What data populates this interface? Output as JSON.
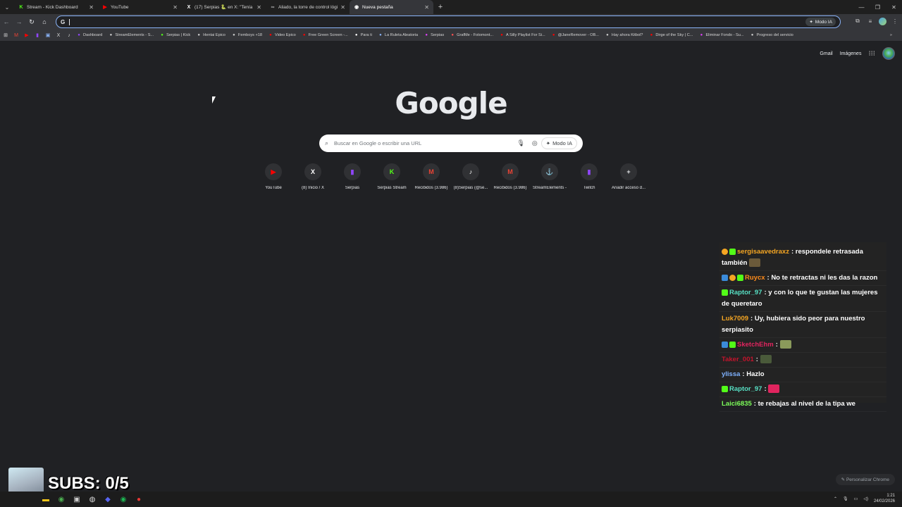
{
  "tabs": [
    {
      "title": "Stream - Kick Dashboard",
      "favicon": "kick-icon",
      "color": "#53fc18",
      "glyph": "K"
    },
    {
      "title": "YouTube",
      "favicon": "youtube-icon",
      "color": "#ff0000",
      "glyph": "▶"
    },
    {
      "title": "(17) Serpias 🐍 en X: \"Tenía un",
      "favicon": "x-icon",
      "color": "#ffffff",
      "glyph": "X"
    },
    {
      "title": "Aliado, la torre de control lógic",
      "favicon": "site-icon",
      "color": "#aaaaaa",
      "glyph": "∞"
    },
    {
      "title": "Nueva pestaña",
      "favicon": "chrome-icon",
      "color": "#ffffff",
      "glyph": "◉"
    }
  ],
  "omnibox": {
    "modo_ia": "Modo IA"
  },
  "bookmarks": [
    {
      "label": "Dashboard",
      "color": "#9146ff"
    },
    {
      "label": "StreamElements - S...",
      "color": "#cccccc"
    },
    {
      "label": "Serpias | Kick",
      "color": "#53fc18"
    },
    {
      "label": "Hentai Epico",
      "color": "#cccccc"
    },
    {
      "label": "Femboys +18",
      "color": "#cccccc"
    },
    {
      "label": "Video Epico",
      "color": "#ff0000"
    },
    {
      "label": "Free Green Screen -...",
      "color": "#ff0000"
    },
    {
      "label": "Para ti",
      "color": "#ffffff"
    },
    {
      "label": "La Ruleta Aleatoria",
      "color": "#8ab4f8"
    },
    {
      "label": "Serpias",
      "color": "#e040fb"
    },
    {
      "label": "GrafMe - Fotomont...",
      "color": "#ff5252"
    },
    {
      "label": "A Silly Playlist For Si...",
      "color": "#ff0000"
    },
    {
      "label": "@JaneRemover - OB...",
      "color": "#ff0000"
    },
    {
      "label": "Hay ahora Kitbol?",
      "color": "#cccccc"
    },
    {
      "label": "Dirge of the Sky | C...",
      "color": "#ff0000"
    },
    {
      "label": "Eliminar Fondo - Su...",
      "color": "#e040fb"
    },
    {
      "label": "Progreso del servicio",
      "color": "#cccccc"
    }
  ],
  "top_links": {
    "gmail": "Gmail",
    "imagenes": "Imágenes"
  },
  "logo": "Google",
  "search": {
    "placeholder": "Buscar en Google o escribir una URL",
    "modo_ia": "Modo IA"
  },
  "shortcuts": [
    {
      "label": "YouTube",
      "glyph": "▶",
      "color": "#ff0000",
      "icon": "youtube-icon"
    },
    {
      "label": "(8) Inicio / X",
      "glyph": "X",
      "color": "#ffffff",
      "icon": "x-icon"
    },
    {
      "label": "Serpias",
      "glyph": "▮",
      "color": "#9146ff",
      "icon": "twitch-icon"
    },
    {
      "label": "Serpias Stream",
      "glyph": "K",
      "color": "#53fc18",
      "icon": "kick-icon"
    },
    {
      "label": "Recibidos (3.986)",
      "glyph": "M",
      "color": "#ea4335",
      "icon": "gmail-icon"
    },
    {
      "label": "(8)Serpias (@se...",
      "glyph": "♪",
      "color": "#ffffff",
      "icon": "tiktok-icon"
    },
    {
      "label": "Recibidos (3.986)",
      "glyph": "M",
      "color": "#ea4335",
      "icon": "gmail-icon"
    },
    {
      "label": "StreamElements -",
      "glyph": "⚓",
      "color": "#ffffff",
      "icon": "streamelements-icon"
    },
    {
      "label": "Twitch",
      "glyph": "▮",
      "color": "#9146ff",
      "icon": "twitch-icon"
    },
    {
      "label": "Añadir acceso d...",
      "glyph": "+",
      "color": "#e8eaed",
      "icon": "add-icon"
    }
  ],
  "chat": [
    {
      "badges": [
        "orange",
        "green"
      ],
      "user": "sergisaavedraxz",
      "color": "#f5a623",
      "text": ": respondele retrasada también",
      "emote": "#6b5a3a"
    },
    {
      "badges": [
        "blue",
        "orange",
        "green"
      ],
      "user": "Ruycx",
      "color": "#ff8c1a",
      "text": ": No te retractas ni les das la razon",
      "emote": ""
    },
    {
      "badges": [
        "green"
      ],
      "user": "Raptor_97",
      "color": "#57e0c4",
      "text": ": y con lo que te gustan las mujeres de queretaro",
      "emote": ""
    },
    {
      "badges": [],
      "user": "Luk7009",
      "color": "#f5a623",
      "text": ": Uy, hubiera sido peor para nuestro serpiasito",
      "emote": ""
    },
    {
      "badges": [
        "blue",
        "green"
      ],
      "user": "SketchEhm",
      "color": "#e0245e",
      "text": ":",
      "emote": "#8a9a5b"
    },
    {
      "badges": [],
      "user": "Taker_001",
      "color": "#c4142c",
      "text": ":",
      "emote": "#4a5a3a"
    },
    {
      "badges": [],
      "user": "ylissa",
      "color": "#7fb2ff",
      "text": ": Hazlo",
      "emote": ""
    },
    {
      "badges": [
        "green"
      ],
      "user": "Raptor_97",
      "color": "#57e0c4",
      "text": ":",
      "emote": "#e0245e"
    },
    {
      "badges": [],
      "user": "Laici6835",
      "color": "#7dff5a",
      "text": ": te rebajas al nivel de la tipa we",
      "emote": ""
    }
  ],
  "overlay": {
    "subs": "SUBS: 0/5"
  },
  "customize": "Personalizar Chrome",
  "clock": {
    "time": "1:21",
    "date": "24/02/2026"
  }
}
